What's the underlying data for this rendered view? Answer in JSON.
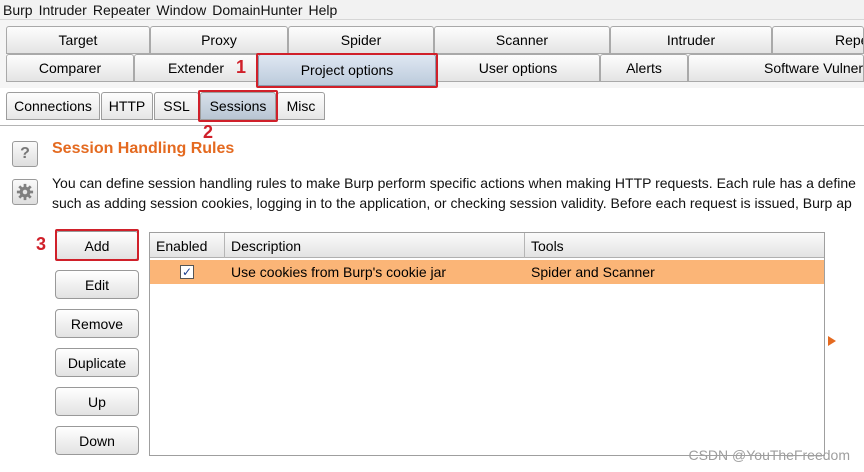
{
  "menubar": [
    "Burp",
    "Intruder",
    "Repeater",
    "Window",
    "DomainHunter",
    "Help"
  ],
  "tabs_row1": [
    "Target",
    "Proxy",
    "Spider",
    "Scanner",
    "Intruder",
    "Repe"
  ],
  "tabs_row2": [
    "Comparer",
    "Extender",
    "Project options",
    "User options",
    "Alerts",
    "Software Vulnera"
  ],
  "active_tab": "Project options",
  "subtabs": [
    "Connections",
    "HTTP",
    "SSL",
    "Sessions",
    "Misc"
  ],
  "active_subtab": "Sessions",
  "annotations": [
    "1",
    "2",
    "3"
  ],
  "section": {
    "help_icon": "?",
    "title": "Session Handling Rules",
    "description_line1": "You can define session handling rules to make Burp perform specific actions when making HTTP requests. Each rule has a define",
    "description_line2": "such as adding session cookies, logging in to the application, or checking session validity. Before each request is issued, Burp ap"
  },
  "buttons": [
    "Add",
    "Edit",
    "Remove",
    "Duplicate",
    "Up",
    "Down"
  ],
  "table": {
    "columns": [
      "Enabled",
      "Description",
      "Tools"
    ],
    "rows": [
      {
        "enabled": true,
        "description": "Use cookies from Burp's cookie jar",
        "tools": "Spider and Scanner"
      }
    ]
  },
  "colors": {
    "accent": "#e46a20",
    "highlight_row": "#fbb577",
    "annotation_red": "#d0202a"
  },
  "watermark": "CSDN @YouTheFreedom"
}
